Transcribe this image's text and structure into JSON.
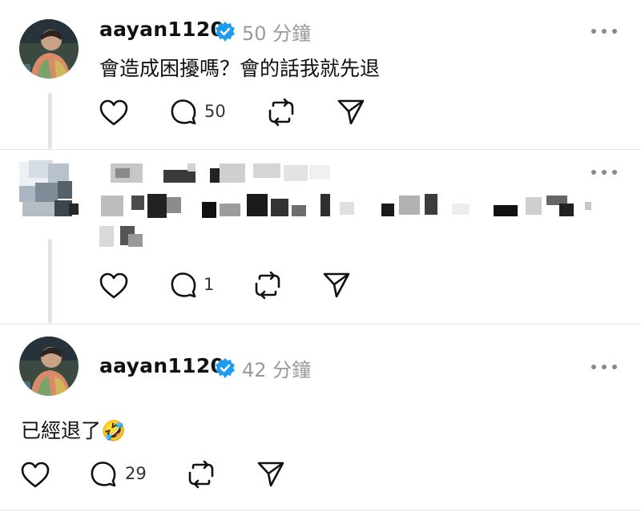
{
  "posts": [
    {
      "username": "aayan1120",
      "time": "50 分鐘",
      "text": "會造成困擾嗎？會的話我就先退",
      "reply_count": "50"
    },
    {
      "reply_count": "1"
    },
    {
      "username": "aayan1120",
      "time": "42 分鐘",
      "text": "已經退了🤣",
      "reply_count": "29"
    }
  ],
  "icons": {
    "like": "heart-icon",
    "reply": "comment-icon",
    "repost": "repost-icon",
    "share": "send-icon",
    "more": "more-icon",
    "verified": "verified-badge-icon"
  },
  "colors": {
    "verified": "#1d9bf0",
    "muted": "#9a9a9a",
    "text": "#111111"
  }
}
